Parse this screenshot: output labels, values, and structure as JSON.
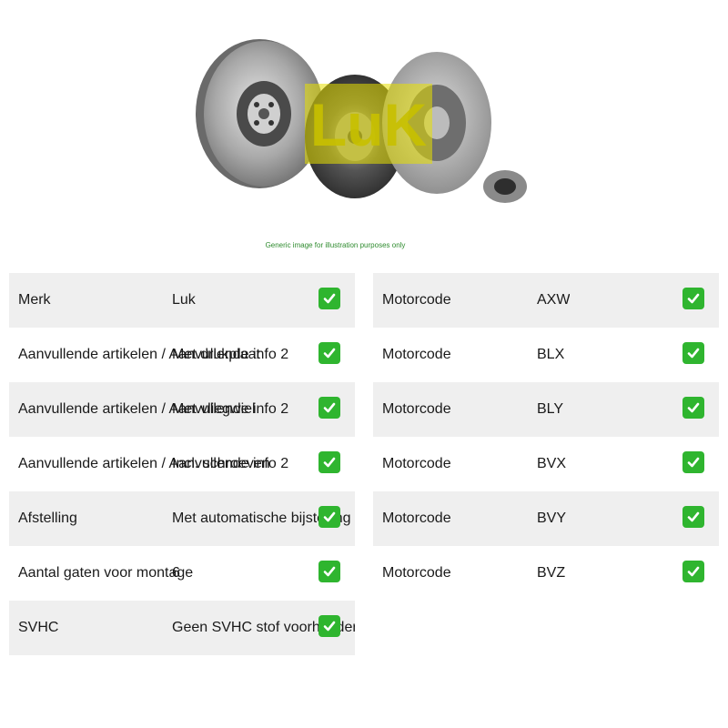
{
  "image": {
    "caption": "Generic image for illustration purposes only",
    "logo_text": "LuK"
  },
  "left_table": [
    {
      "label": "Merk",
      "value": "Luk",
      "value2": ""
    },
    {
      "label": "Aanvullende artikelen / Aanvullende info 2",
      "value": "Met drukplaat",
      "value2": ""
    },
    {
      "label": "Aanvullende artikelen / Aanvullende info 2",
      "value": "Met vliegwiel",
      "value2": ""
    },
    {
      "label": "Aanvullende artikelen / Aanvullende info 2",
      "value": "Incl. schroeven",
      "value2": ""
    },
    {
      "label": "Afstelling",
      "value": "Met automatische bijstelling",
      "value2": ""
    },
    {
      "label": "Aantal gaten voor montage",
      "value": "6",
      "value2": ""
    },
    {
      "label": "SVHC",
      "value": "Geen SVHC stof voorhanden",
      "value2": ""
    }
  ],
  "right_table": [
    {
      "label": "Motorcode",
      "value": "AXW"
    },
    {
      "label": "Motorcode",
      "value": "BLX"
    },
    {
      "label": "Motorcode",
      "value": "BLY"
    },
    {
      "label": "Motorcode",
      "value": "BVX"
    },
    {
      "label": "Motorcode",
      "value": "BVY"
    },
    {
      "label": "Motorcode",
      "value": "BVZ"
    }
  ],
  "colors": {
    "check": "#2fb52f",
    "row_shade": "#efefef",
    "caption": "#2e8b2e",
    "logo": "#e8e000"
  },
  "icons": {
    "check": "check-mark-icon"
  }
}
